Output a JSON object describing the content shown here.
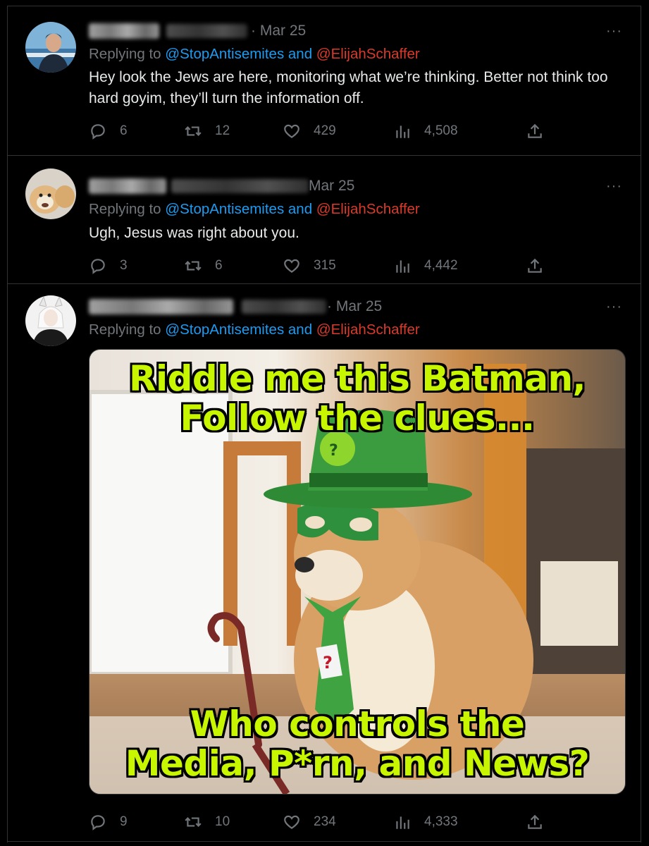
{
  "tweets": [
    {
      "date": "· Mar 25",
      "reply_prefix": "Replying to",
      "mention_a": "@StopAntisemites",
      "conjunction": "and",
      "mention_b": "@ElijahSchaffer",
      "text": "Hey look the Jews are here, monitoring what we’re thinking. Better not think too hard goyim, they’ll turn the information off.",
      "replies": "6",
      "retweets": "12",
      "likes": "429",
      "views": "4,508",
      "more": "···"
    },
    {
      "date": "Mar 25",
      "reply_prefix": "Replying to",
      "mention_a": "@StopAntisemites",
      "conjunction": "and",
      "mention_b": "@ElijahSchaffer",
      "text": "Ugh, Jesus was right about you.",
      "replies": "3",
      "retweets": "6",
      "likes": "315",
      "views": "4,442",
      "more": "···"
    },
    {
      "date": "· Mar 25",
      "reply_prefix": "Replying to",
      "mention_a": "@StopAntisemites",
      "conjunction": "and",
      "mention_b": "@ElijahSchaffer",
      "meme_top_1": "Riddle me this Batman,",
      "meme_top_2": "Follow the clues...",
      "meme_bottom_1": "Who controls the",
      "meme_bottom_2": "Media, P*rn, and News?",
      "replies": "9",
      "retweets": "10",
      "likes": "234",
      "views": "4,333",
      "more": "···"
    }
  ],
  "colors": {
    "background": "#000000",
    "muted": "#71767b",
    "link": "#1d9bf0",
    "mention_red": "#d93a2b",
    "meme_text": "#c8f500"
  },
  "icons": [
    "reply-icon",
    "retweet-icon",
    "like-icon",
    "views-icon",
    "share-icon",
    "more-icon"
  ]
}
